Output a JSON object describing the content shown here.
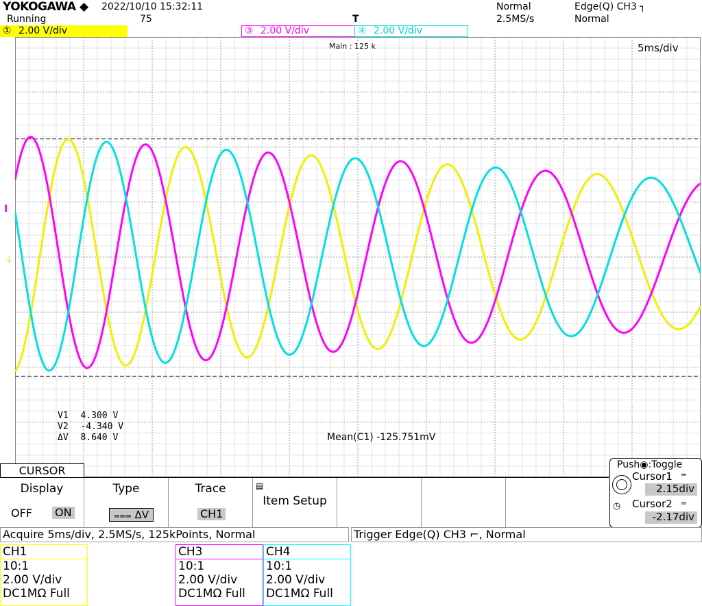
{
  "header": {
    "brand": "YOKOGAWA",
    "brand_mark": "◆",
    "datetime": "2022/10/10  15:32:11",
    "run_state": "Running",
    "acq_count": "75",
    "trigger_mode": "Normal",
    "sample_rate": "2.5MS/s",
    "trigger_type": "Edge(Q) CH3",
    "trigger_slope_icon": "rising-edge-icon",
    "trigger_mode2": "Normal",
    "trigger_position_marker": "T"
  },
  "channel_tabs": [
    {
      "num": "①",
      "text": "2.00 V/div",
      "color": "#ffff00"
    },
    {
      "num": "③",
      "text": "2.00 V/div",
      "color": "#ff00ff"
    },
    {
      "num": "④",
      "text": "2.00 V/div",
      "color": "#00ffff"
    }
  ],
  "screen": {
    "zoom_label": "Main : 125 k",
    "timebase": "5ms/div",
    "cursor_readout": {
      "v1_label": "V1",
      "v1_value": "4.300  V",
      "v2_label": "V2",
      "v2_value": "-4.340  V",
      "dv_label": "ΔV",
      "dv_value": "8.640  V"
    },
    "measurement": "Mean(C1) -125.751mV"
  },
  "waveforms": [
    {
      "name": "CH1",
      "color": "#f0f000"
    },
    {
      "name": "CH3",
      "color": "#ff00ff"
    },
    {
      "name": "CH4",
      "color": "#00e0e0"
    }
  ],
  "menu": {
    "title": "CURSOR",
    "display_label": "Display",
    "display_off": "OFF",
    "display_on": "ON",
    "type_label": "Type",
    "type_value": "⩶ ΔV",
    "trace_label": "Trace",
    "trace_value": "CH1",
    "item_setup_label": "Item Setup"
  },
  "cursor_panel": {
    "push_toggle": "Push",
    "toggle_text": ":Toggle",
    "cursor1_label": "Cursor1",
    "cursor1_value": "2.15div",
    "cursor2_label": "Cursor2",
    "cursor2_value": "-2.17div"
  },
  "status": {
    "acquire": "Acquire 5ms/div, 2.5MS/s, 125kPoints, Normal",
    "trigger": "Trigger Edge(Q) CH3 ⌐, Normal"
  },
  "channel_info": [
    {
      "name": "CH1",
      "probe": "10:1",
      "scale": "2.00 V/div",
      "coupling": "DC1MΩ Full",
      "color": "#ffff00"
    },
    {
      "name": "CH3",
      "probe": "10:1",
      "scale": "2.00 V/div",
      "coupling": "DC1MΩ Full",
      "color": "#ff00ff"
    },
    {
      "name": "CH4",
      "probe": "10:1",
      "scale": "2.00 V/div",
      "coupling": "DC1MΩ Full",
      "color": "#00ffff"
    }
  ]
}
